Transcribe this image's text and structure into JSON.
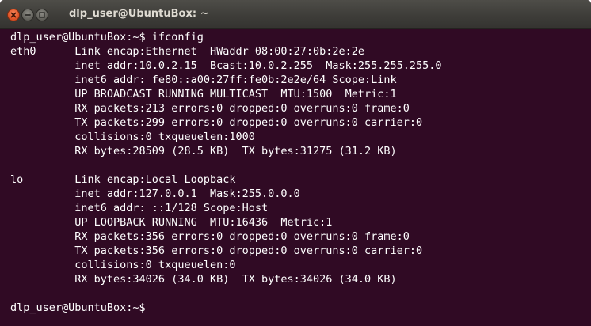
{
  "window": {
    "title": "dlp_user@UbuntuBox: ~",
    "buttons": [
      "close-icon",
      "minimize-icon",
      "maximize-icon"
    ],
    "colors": {
      "background": "#300a24",
      "text": "#ffffff",
      "close_button": "#e4582b"
    }
  },
  "terminal": {
    "lines": [
      "dlp_user@UbuntuBox:~$ ifconfig",
      "eth0      Link encap:Ethernet  HWaddr 08:00:27:0b:2e:2e",
      "          inet addr:10.0.2.15  Bcast:10.0.2.255  Mask:255.255.255.0",
      "          inet6 addr: fe80::a00:27ff:fe0b:2e2e/64 Scope:Link",
      "          UP BROADCAST RUNNING MULTICAST  MTU:1500  Metric:1",
      "          RX packets:213 errors:0 dropped:0 overruns:0 frame:0",
      "          TX packets:299 errors:0 dropped:0 overruns:0 carrier:0",
      "          collisions:0 txqueuelen:1000",
      "          RX bytes:28509 (28.5 KB)  TX bytes:31275 (31.2 KB)",
      "",
      "lo        Link encap:Local Loopback",
      "          inet addr:127.0.0.1  Mask:255.0.0.0",
      "          inet6 addr: ::1/128 Scope:Host",
      "          UP LOOPBACK RUNNING  MTU:16436  Metric:1",
      "          RX packets:356 errors:0 dropped:0 overruns:0 frame:0",
      "          TX packets:356 errors:0 dropped:0 overruns:0 carrier:0",
      "          collisions:0 txqueuelen:0",
      "          RX bytes:34026 (34.0 KB)  TX bytes:34026 (34.0 KB)",
      "",
      "dlp_user@UbuntuBox:~$"
    ]
  }
}
